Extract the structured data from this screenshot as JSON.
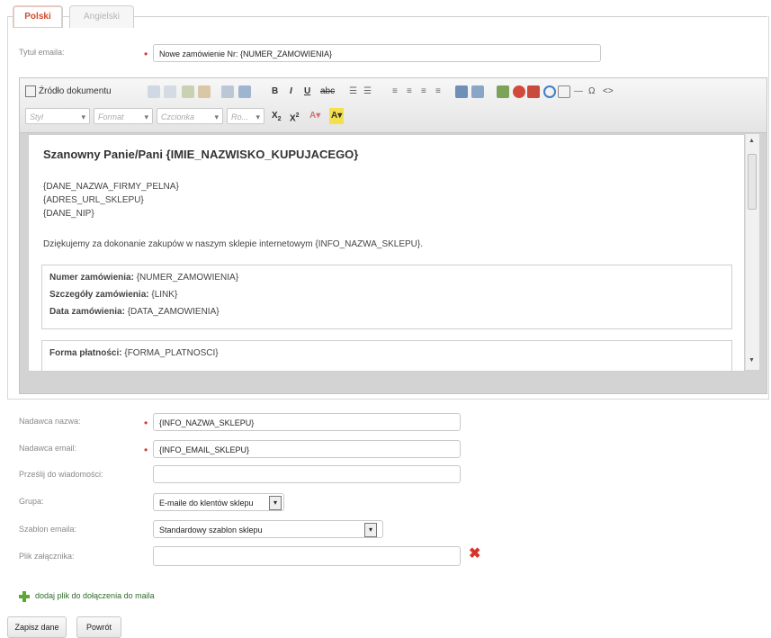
{
  "tabs": [
    {
      "label": "Polski"
    },
    {
      "label": "Angielski"
    }
  ],
  "form": {
    "subject_label": "Tytuł emaila:",
    "subject_value": "Nowe zamówienie Nr: {NUMER_ZAMOWIENIA}",
    "sender_name_label": "Nadawca nazwa:",
    "sender_name_value": "{INFO_NAZWA_SKLEPU}",
    "sender_email_label": "Nadawca email:",
    "sender_email_value": "{INFO_EMAIL_SKLEPU}",
    "forward_label": "Prześlij do wiadomości:",
    "forward_value": "",
    "group_label": "Grupa:",
    "group_value": "E-maile do klentów sklepu",
    "template_label": "Szablon emaila:",
    "template_value": "Standardowy szablon sklepu",
    "attachment_label": "Plik załącznika:",
    "attachment_value": "",
    "add_file_link": "dodaj plik do dołączenia do maila"
  },
  "editor": {
    "source_label": "Źródło dokumentu",
    "style_combo": "Styl",
    "format_combo": "Format",
    "font_combo": "Czcionka",
    "size_combo": "Ro...",
    "content": {
      "greeting": "Szanowny Panie/Pani {IMIE_NAZWISKO_KUPUJACEGO}",
      "line1": "{DANE_NAZWA_FIRMY_PELNA}",
      "line2": "{ADRES_URL_SKLEPU}",
      "line3": "{DANE_NIP}",
      "thanks": "Dziękujemy za dokonanie zakupów w naszym sklepie internetowym {INFO_NAZWA_SKLEPU}.",
      "order_no_label": "Numer zamówienia:",
      "order_no_value": "{NUMER_ZAMOWIENIA}",
      "details_label": "Szczegóły zamówienia:",
      "details_value": "{LINK}",
      "date_label": "Data zamówienia:",
      "date_value": "{DATA_ZAMOWIENIA}",
      "payment_label": "Forma płatności:",
      "payment_value": "{FORMA_PLATNOSCI}"
    }
  },
  "buttons": {
    "save": "Zapisz dane",
    "back": "Powrót"
  },
  "colors": {
    "accent_tab": "#d24a2d",
    "required_star": "#d33333",
    "delete_icon": "#d9342b",
    "add_icon": "#5aa832"
  }
}
